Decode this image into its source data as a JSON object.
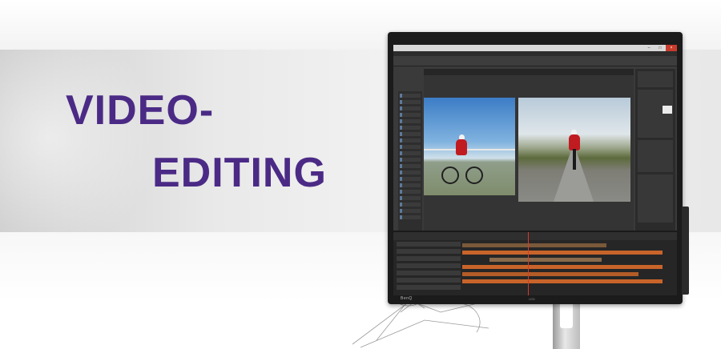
{
  "headline": {
    "line1": "VIDEO-",
    "line2": "EDITING"
  },
  "monitor": {
    "brand": "BenQ",
    "bezel_logo": "LED"
  },
  "colors": {
    "headline": "#4b2a86",
    "rider_jersey": "#c11b22",
    "track_orange": "#c8642a",
    "playhead": "#d83a2a"
  },
  "icons": [
    "minimize-icon",
    "maximize-icon",
    "close-icon"
  ]
}
